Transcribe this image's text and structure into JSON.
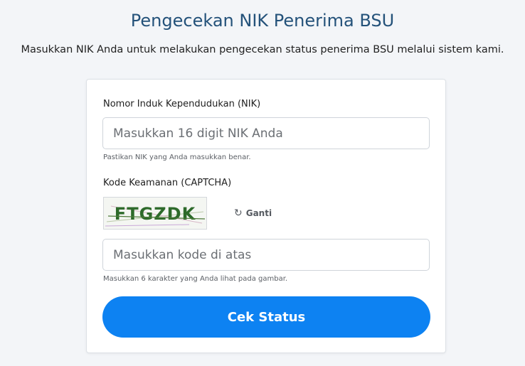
{
  "header": {
    "title": "Pengecekan NIK Penerima BSU",
    "subtitle": "Masukkan NIK Anda untuk melakukan pengecekan status penerima BSU melalui sistem kami."
  },
  "form": {
    "nik": {
      "label": "Nomor Induk Kependudukan (NIK)",
      "placeholder": "Masukkan 16 digit NIK Anda",
      "value": "",
      "hint": "Pastikan NIK yang Anda masukkan benar."
    },
    "captcha": {
      "label": "Kode Keamanan (CAPTCHA)",
      "code": "FTGZDK",
      "refresh_label": "Ganti",
      "refresh_icon": "refresh-icon",
      "placeholder": "Masukkan kode di atas",
      "value": "",
      "hint": "Masukkan 6 karakter yang Anda lihat pada gambar."
    },
    "submit_label": "Cek Status"
  },
  "colors": {
    "title": "#24527a",
    "button": "#0d82f2",
    "captcha_text": "#2d6a2a",
    "background": "#f3f5f8"
  }
}
